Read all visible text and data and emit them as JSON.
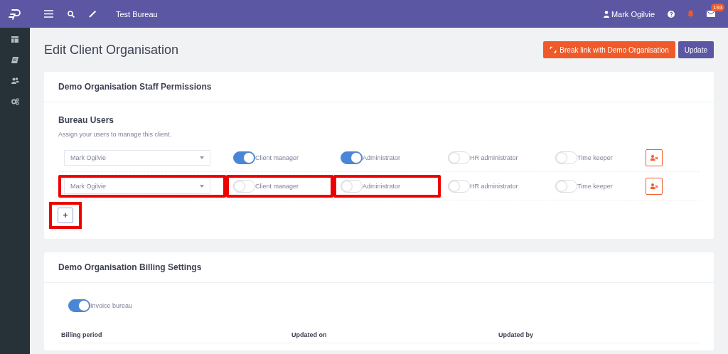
{
  "topbar": {
    "org": "Test Bureau",
    "user": "Mark Ogilvie",
    "mail_badge": "193"
  },
  "page": {
    "title": "Edit Client Organisation",
    "buttons": [
      {
        "kind": "break",
        "label": "Break link with Demo Organisation"
      },
      {
        "kind": "primary",
        "label": "Update"
      }
    ]
  },
  "staff": {
    "title": "Demo Organisation Staff Permissions",
    "subtitle": "Bureau Users",
    "hint": "Assign your users to manage this client.",
    "rows": [
      {
        "user": "Mark Ogilvie",
        "user_highlighted": false,
        "roles": [
          {
            "label": "Client manager",
            "on": true,
            "highlighted": false
          },
          {
            "label": "Administrator",
            "on": true,
            "highlighted": false
          },
          {
            "label": "HR administrator",
            "on": false,
            "highlighted": false
          },
          {
            "label": "Time keeper",
            "on": false,
            "highlighted": false
          }
        ]
      },
      {
        "user": "Mark Ogilvie",
        "user_highlighted": true,
        "roles": [
          {
            "label": "Client manager",
            "on": false,
            "highlighted": true
          },
          {
            "label": "Administrator",
            "on": false,
            "highlighted": true
          },
          {
            "label": "HR administrator",
            "on": false,
            "highlighted": false
          },
          {
            "label": "Time keeper",
            "on": false,
            "highlighted": false
          }
        ]
      }
    ],
    "add": {
      "label": "+",
      "highlighted": true
    }
  },
  "billing": {
    "title": "Demo Organisation Billing Settings",
    "invoice": {
      "label": "Invoice bureau",
      "on": true
    },
    "columns": [
      "Billing period",
      "Updated on",
      "Updated by"
    ]
  }
}
